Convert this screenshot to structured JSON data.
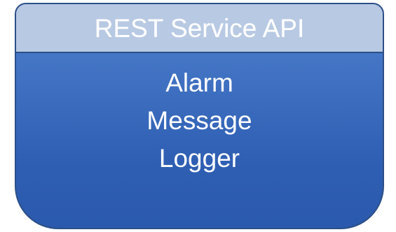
{
  "component": {
    "title": "REST Service API",
    "items": [
      {
        "label": "Alarm"
      },
      {
        "label": "Message"
      },
      {
        "label": "Logger"
      }
    ]
  },
  "colors": {
    "header_fill": "#b8c9e3",
    "body_fill_top": "#4f81cf",
    "body_fill_bottom": "#2a59ad",
    "border": "#2d4f86",
    "text": "#ffffff"
  }
}
